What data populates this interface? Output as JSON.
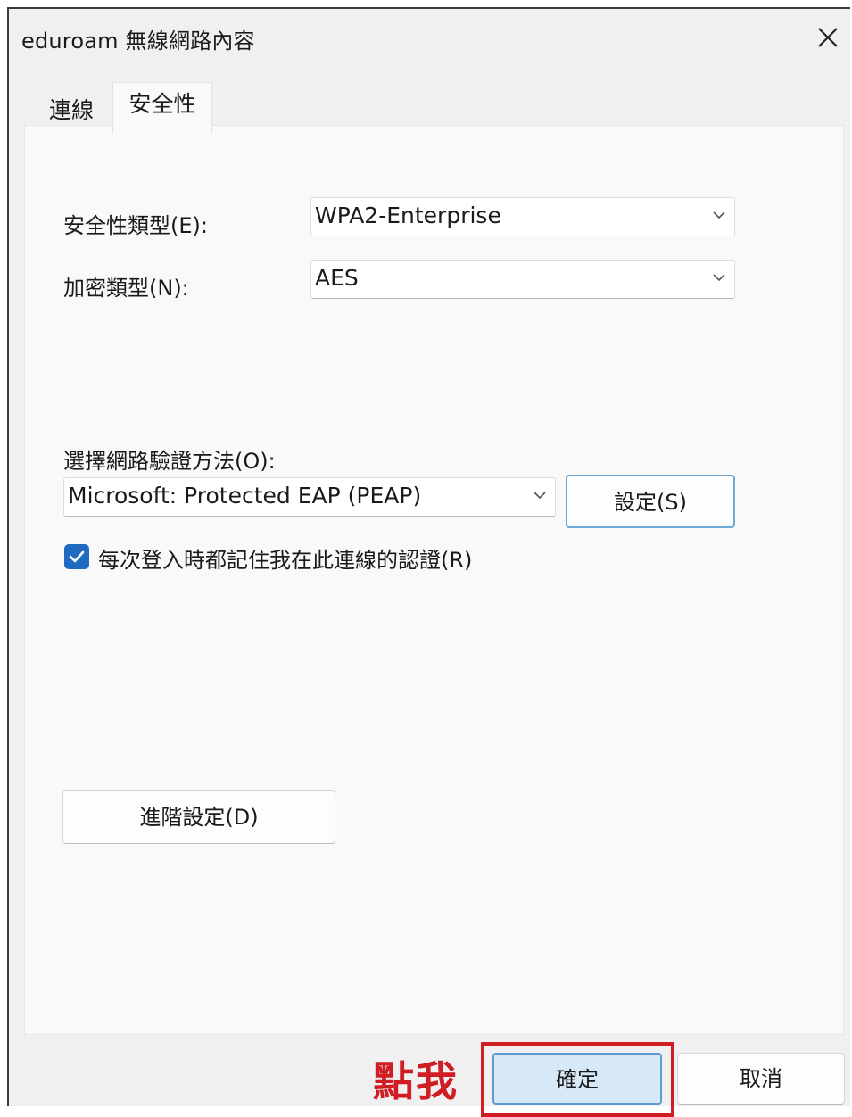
{
  "window": {
    "title": "eduroam 無線網路內容"
  },
  "tabs": [
    {
      "label": "連線",
      "selected": false
    },
    {
      "label": "安全性",
      "selected": true
    }
  ],
  "security": {
    "security_type_label": "安全性類型(E):",
    "security_type_value": "WPA2-Enterprise",
    "encryption_type_label": "加密類型(N):",
    "encryption_type_value": "AES",
    "auth_method_label": "選擇網路驗證方法(O):",
    "auth_method_value": "Microsoft: Protected EAP (PEAP)",
    "settings_button": "設定(S)",
    "remember_checkbox_label": "每次登入時都記住我在此連線的認證(R)",
    "remember_checked": true,
    "advanced_button": "進階設定(D)"
  },
  "footer": {
    "annotation": "點我",
    "ok_button": "確定",
    "cancel_button": "取消"
  },
  "colors": {
    "accent": "#1f6bbf",
    "annotation_red": "#d01c23"
  }
}
